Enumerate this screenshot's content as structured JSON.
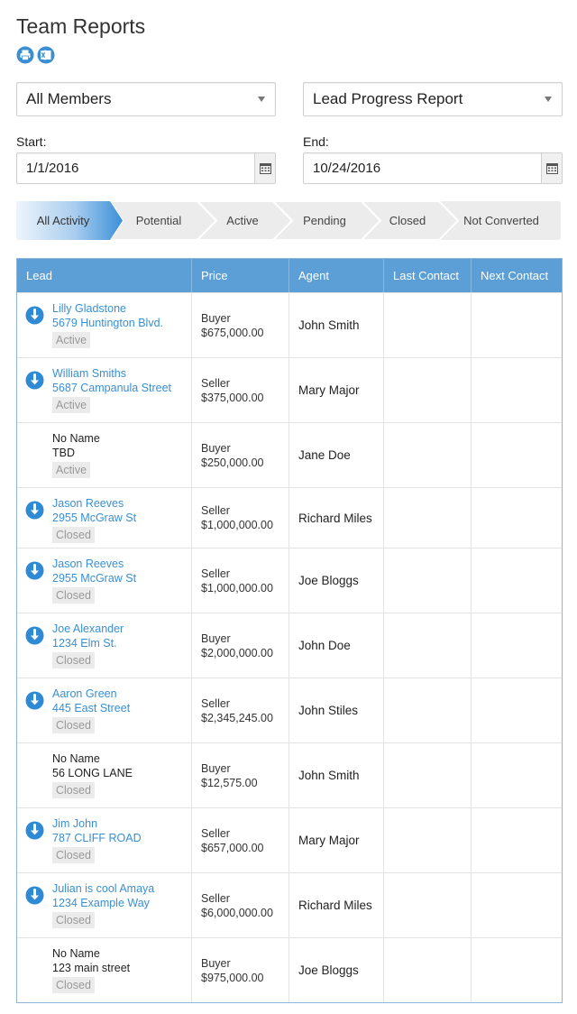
{
  "page": {
    "title": "Team Reports"
  },
  "toolbar": {
    "print_icon": "print-icon",
    "excel_icon": "excel-export-icon",
    "icon_color": "#3a8fd3"
  },
  "filters": {
    "members_select": "All Members",
    "report_select": "Lead Progress Report",
    "start_label": "Start:",
    "start_value": "1/1/2016",
    "end_label": "End:",
    "end_value": "10/24/2016"
  },
  "progress_steps": [
    {
      "label": "All Activity",
      "active": true
    },
    {
      "label": "Potential",
      "active": false
    },
    {
      "label": "Active",
      "active": false
    },
    {
      "label": "Pending",
      "active": false
    },
    {
      "label": "Closed",
      "active": false
    },
    {
      "label": "Not Converted",
      "active": false
    }
  ],
  "table": {
    "headers": [
      "Lead",
      "Price",
      "Agent",
      "Last Contact",
      "Next Contact"
    ],
    "header_color": "#5b9fd6",
    "rows": [
      {
        "name": "Lilly Gladstone",
        "address": "5679 Huntington Blvd.",
        "status": "Active",
        "linked": true,
        "type": "Buyer",
        "price": "$675,000.00",
        "agent": "John Smith",
        "last_contact": "",
        "next_contact": ""
      },
      {
        "name": "William Smiths",
        "address": "5687 Campanula Street",
        "status": "Active",
        "linked": true,
        "type": "Seller",
        "price": "$375,000.00",
        "agent": "Mary Major",
        "last_contact": "",
        "next_contact": ""
      },
      {
        "name": "No Name",
        "address": "TBD",
        "status": "Active",
        "linked": false,
        "type": "Buyer",
        "price": "$250,000.00",
        "agent": "Jane Doe",
        "last_contact": "",
        "next_contact": ""
      },
      {
        "name": "Jason Reeves",
        "address": "2955 McGraw St",
        "status": "Closed",
        "linked": true,
        "type": "Seller",
        "price": "$1,000,000.00",
        "agent": "Richard Miles",
        "last_contact": "",
        "next_contact": ""
      },
      {
        "name": "Jason Reeves",
        "address": "2955 McGraw St",
        "status": "Closed",
        "linked": true,
        "type": "Seller",
        "price": "$1,000,000.00",
        "agent": "Joe Bloggs",
        "last_contact": "",
        "next_contact": ""
      },
      {
        "name": "Joe Alexander",
        "address": "1234 Elm St.",
        "status": "Closed",
        "linked": true,
        "type": "Buyer",
        "price": "$2,000,000.00",
        "agent": "John Doe",
        "last_contact": "",
        "next_contact": ""
      },
      {
        "name": "Aaron Green",
        "address": "445 East Street",
        "status": "Closed",
        "linked": true,
        "type": "Seller",
        "price": "$2,345,245.00",
        "agent": "John Stiles",
        "last_contact": "",
        "next_contact": ""
      },
      {
        "name": "No Name",
        "address": "56 LONG LANE",
        "status": "Closed",
        "linked": false,
        "type": "Buyer",
        "price": "$12,575.00",
        "agent": "John Smith",
        "last_contact": "",
        "next_contact": ""
      },
      {
        "name": "Jim John",
        "address": "787 CLIFF ROAD",
        "status": "Closed",
        "linked": true,
        "type": "Seller",
        "price": "$657,000.00",
        "agent": "Mary Major",
        "last_contact": "",
        "next_contact": ""
      },
      {
        "name": "Julian is cool Amaya",
        "address": "1234 Example Way",
        "status": "Closed",
        "linked": true,
        "type": "Seller",
        "price": "$6,000,000.00",
        "agent": "Richard Miles",
        "last_contact": "",
        "next_contact": ""
      },
      {
        "name": "No Name",
        "address": "123 main street",
        "status": "Closed",
        "linked": false,
        "type": "Buyer",
        "price": "$975,000.00",
        "agent": "Joe Bloggs",
        "last_contact": "",
        "next_contact": ""
      }
    ]
  }
}
